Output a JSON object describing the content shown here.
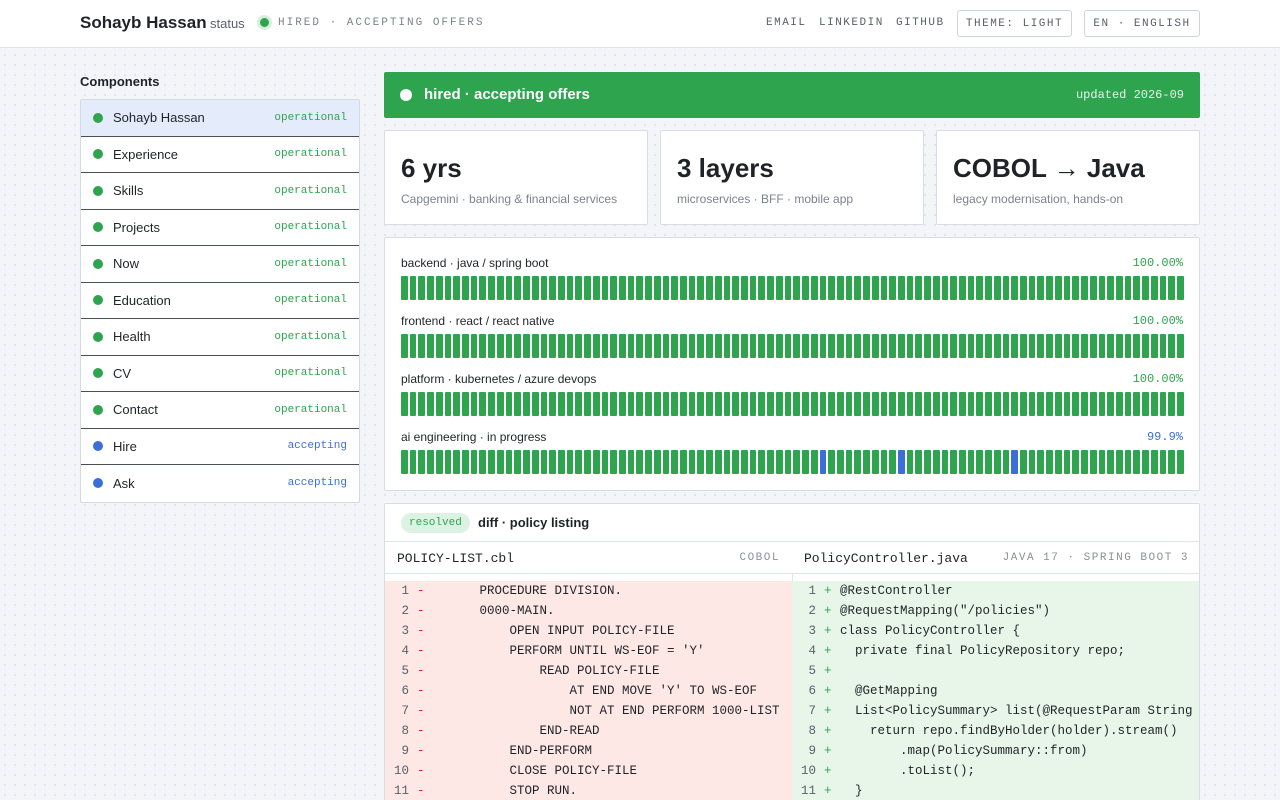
{
  "header": {
    "name": "Sohayb Hassan",
    "status_label": "status",
    "status_text": "HIRED · ACCEPTING OFFERS",
    "nav": [
      "EMAIL",
      "LINKEDIN",
      "GITHUB"
    ],
    "theme_button": "THEME: LIGHT",
    "lang_button": "EN · ENGLISH"
  },
  "sidebar": {
    "title": "Components",
    "items": [
      {
        "label": "Sohayb Hassan",
        "status": "operational",
        "kind": "ok",
        "active": true
      },
      {
        "label": "Experience",
        "status": "operational",
        "kind": "ok"
      },
      {
        "label": "Skills",
        "status": "operational",
        "kind": "ok"
      },
      {
        "label": "Projects",
        "status": "operational",
        "kind": "ok"
      },
      {
        "label": "Now",
        "status": "operational",
        "kind": "ok"
      },
      {
        "label": "Education",
        "status": "operational",
        "kind": "ok"
      },
      {
        "label": "Health",
        "status": "operational",
        "kind": "ok"
      },
      {
        "label": "CV",
        "status": "operational",
        "kind": "ok"
      },
      {
        "label": "Contact",
        "status": "operational",
        "kind": "ok"
      },
      {
        "label": "Hire",
        "status": "accepting",
        "kind": "info"
      },
      {
        "label": "Ask",
        "status": "accepting",
        "kind": "info"
      }
    ]
  },
  "banner": {
    "text": "hired · accepting offers",
    "updated": "updated 2026-09"
  },
  "cards": [
    {
      "value": "6 yrs",
      "sub": "Capgemini · banking & financial services"
    },
    {
      "value": "3 layers",
      "sub": "microservices · BFF · mobile app"
    },
    {
      "value": "COBOL → Java",
      "sub": "legacy modernisation, hands-on"
    }
  ],
  "uptime": [
    {
      "label": "backend · java / spring boot",
      "percent": "100.00%",
      "kind": "ok",
      "blue_bars": []
    },
    {
      "label": "frontend · react / react native",
      "percent": "100.00%",
      "kind": "ok",
      "blue_bars": []
    },
    {
      "label": "platform · kubernetes / azure devops",
      "percent": "100.00%",
      "kind": "ok",
      "blue_bars": []
    },
    {
      "label": "ai engineering · in progress",
      "percent": "99.9%",
      "kind": "info",
      "blue_bars": [
        48,
        57,
        70
      ]
    }
  ],
  "diff": {
    "badge": "resolved",
    "title": "diff · policy listing",
    "left": {
      "file": "POLICY-LIST.cbl",
      "lang": "COBOL",
      "lines": [
        "       PROCEDURE DIVISION.",
        "       0000-MAIN.",
        "           OPEN INPUT POLICY-FILE",
        "           PERFORM UNTIL WS-EOF = 'Y'",
        "               READ POLICY-FILE",
        "                   AT END MOVE 'Y' TO WS-EOF",
        "                   NOT AT END PERFORM 1000-LIST",
        "               END-READ",
        "           END-PERFORM",
        "           CLOSE POLICY-FILE",
        "           STOP RUN."
      ]
    },
    "right": {
      "file": "PolicyController.java",
      "lang": "JAVA 17 · SPRING BOOT 3",
      "lines": [
        "@RestController",
        "@RequestMapping(\"/policies\")",
        "class PolicyController {",
        "  private final PolicyRepository repo;",
        "",
        "  @GetMapping",
        "  List<PolicySummary> list(@RequestParam String ho",
        "    return repo.findByHolder(holder).stream()",
        "        .map(PolicySummary::from)",
        "        .toList();",
        "  }"
      ]
    }
  },
  "colors": {
    "ok": "#2ea44f",
    "info": "#3b6fd8",
    "removed_bg": "#fde8e6",
    "added_bg": "#e8f6ea"
  }
}
